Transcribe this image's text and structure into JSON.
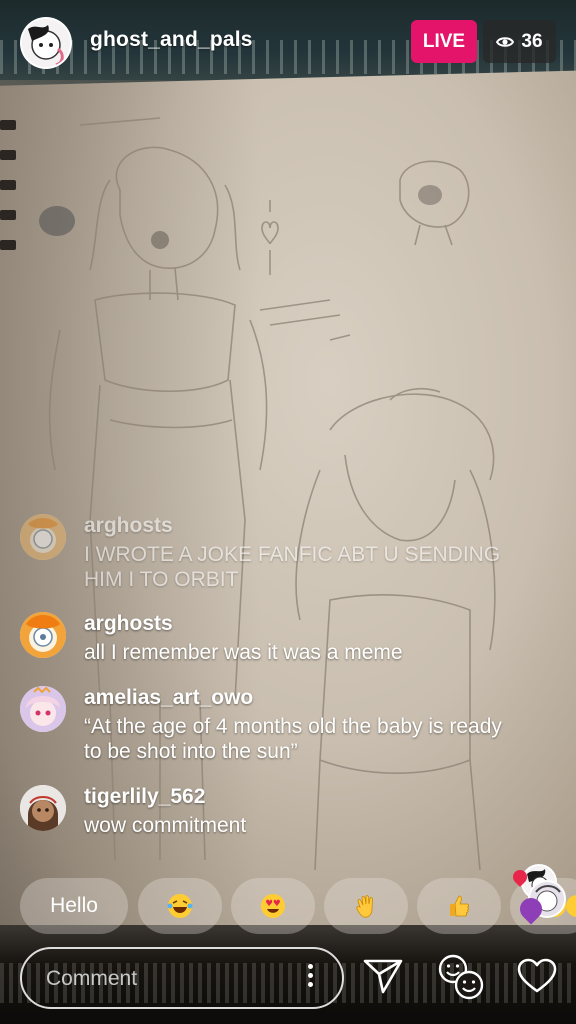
{
  "header": {
    "username": "ghost_and_pals",
    "live_label": "LIVE",
    "viewer_count": "36"
  },
  "comments": [
    {
      "user": "arghosts",
      "text": "I WROTE A JOKE FANFIC ABT U SENDING HIM I TO ORBIT",
      "faded": true
    },
    {
      "user": "arghosts",
      "text": "all I remember was it was a meme"
    },
    {
      "user": "amelias_art_owo",
      "text": "“At the age of 4 months old the baby is ready to be shot into the sun”"
    },
    {
      "user": "tigerlily_562",
      "text": "wow commitment"
    }
  ],
  "quick_reactions": {
    "hello_label": "Hello",
    "emojis": [
      "laughing-tears-icon",
      "heart-eyes-icon",
      "waving-hand-icon",
      "thumbs-up-icon"
    ]
  },
  "comment_input": {
    "placeholder": "Comment"
  },
  "colors": {
    "live": "#e3146a",
    "badge_bg": "#282828"
  }
}
